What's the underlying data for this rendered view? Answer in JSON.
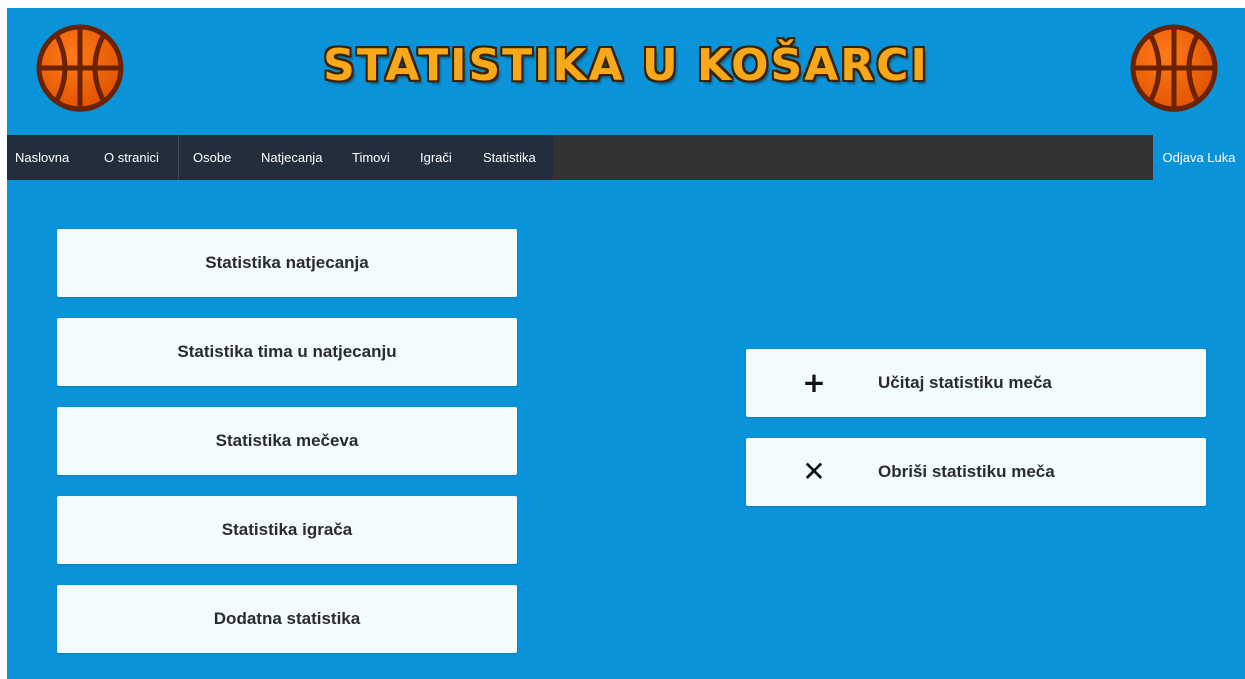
{
  "header": {
    "title": "STATISTIKA U KOŠARCI",
    "left_logo_icon": "basketball-icon",
    "right_logo_icon": "basketball-icon",
    "title_color": "#f7a81b",
    "background_color": "#0a93d9"
  },
  "nav": {
    "items": [
      {
        "label": "Naslovna"
      },
      {
        "label": "O stranici"
      },
      {
        "label": "Osobe"
      },
      {
        "label": "Natjecanja"
      },
      {
        "label": "Timovi"
      },
      {
        "label": "Igrači"
      },
      {
        "label": "Statistika"
      }
    ],
    "logout_label": "Odjava Luka"
  },
  "statistics_menu": {
    "items": [
      {
        "label": "Statistika natjecanja"
      },
      {
        "label": "Statistika tima u natjecanju"
      },
      {
        "label": "Statistika mečeva"
      },
      {
        "label": "Statistika igrača"
      },
      {
        "label": "Dodatna statistika"
      }
    ]
  },
  "actions": {
    "load": {
      "icon": "plus-icon",
      "glyph": "+",
      "label": "Učitaj statistiku meča"
    },
    "delete": {
      "icon": "close-icon",
      "glyph": "✕",
      "label": "Obriši statistiku meča"
    }
  }
}
